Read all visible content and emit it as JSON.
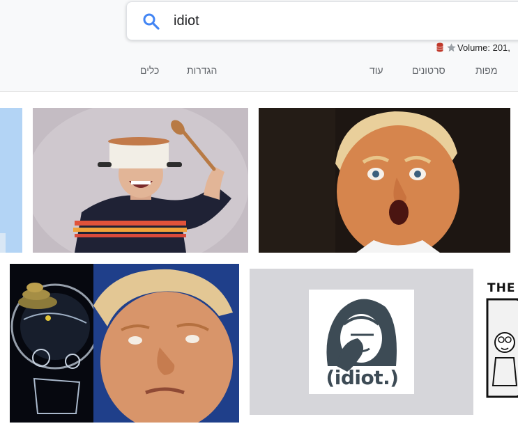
{
  "search": {
    "query": "idiot",
    "icon": "search-icon"
  },
  "toolbar": {
    "volume_label": "Volume: 201,",
    "colors": {
      "accent": "#4285f4",
      "db": "#c0392b",
      "star": "#9aa0a6"
    }
  },
  "tabs": [
    {
      "label": "מפות"
    },
    {
      "label": "סרטונים"
    },
    {
      "label": "עוד"
    },
    {
      "label": "הגדרות"
    },
    {
      "label": "כלים"
    }
  ],
  "results": {
    "row2_card2": {
      "caption": "(idiot.)"
    },
    "row2_card3": {
      "caption": "THE"
    }
  }
}
